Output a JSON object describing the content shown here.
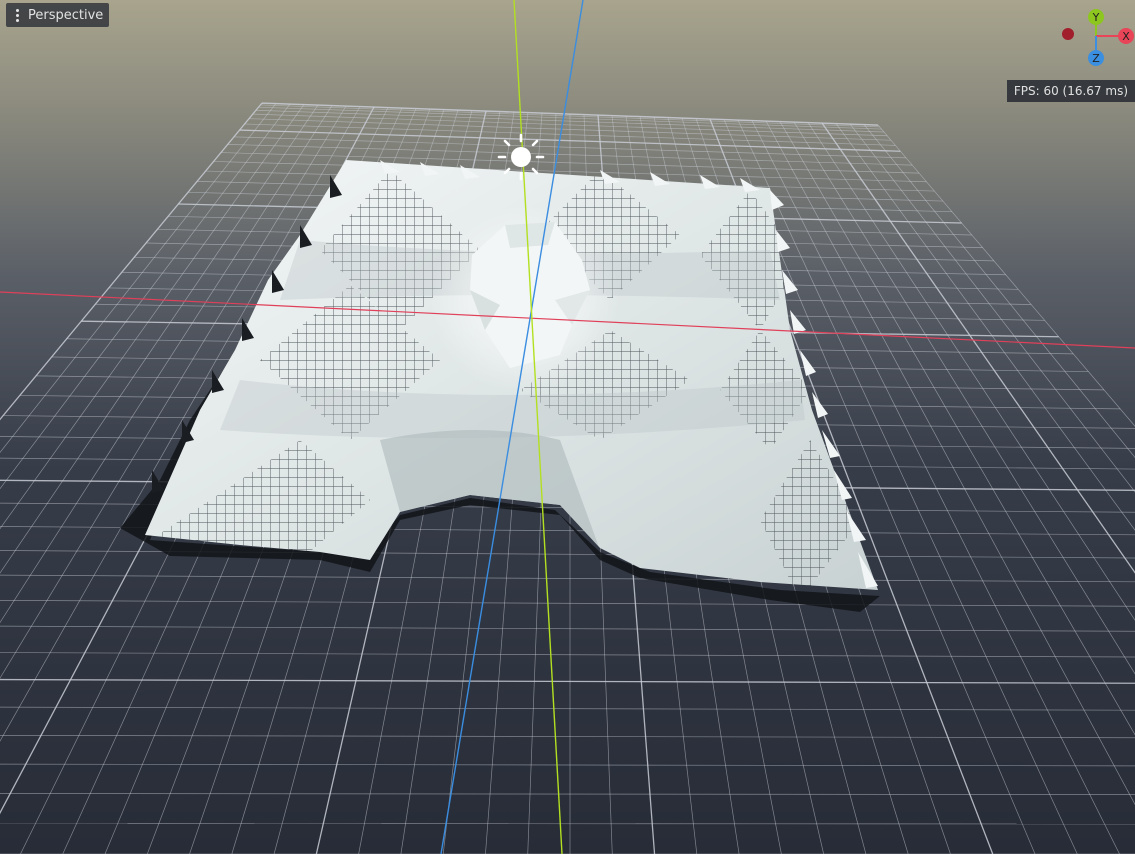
{
  "viewport": {
    "view_menu_label": "Perspective",
    "fps_label": "FPS: 60 (16.67 ms)"
  },
  "gizmo": {
    "axes": [
      {
        "label": "Y",
        "color": "#8cc61f"
      },
      {
        "label": "X",
        "color": "#e94457"
      },
      {
        "label": "Z",
        "color": "#3a8fe0"
      }
    ],
    "neg_x_color": "#a11e2c"
  },
  "colors": {
    "x_axis_line": "#e0405a",
    "y_axis_line": "#b2e020",
    "z_axis_line": "#3a8de0",
    "grid": "#c8ccd4",
    "mesh": "#e8eeee"
  }
}
